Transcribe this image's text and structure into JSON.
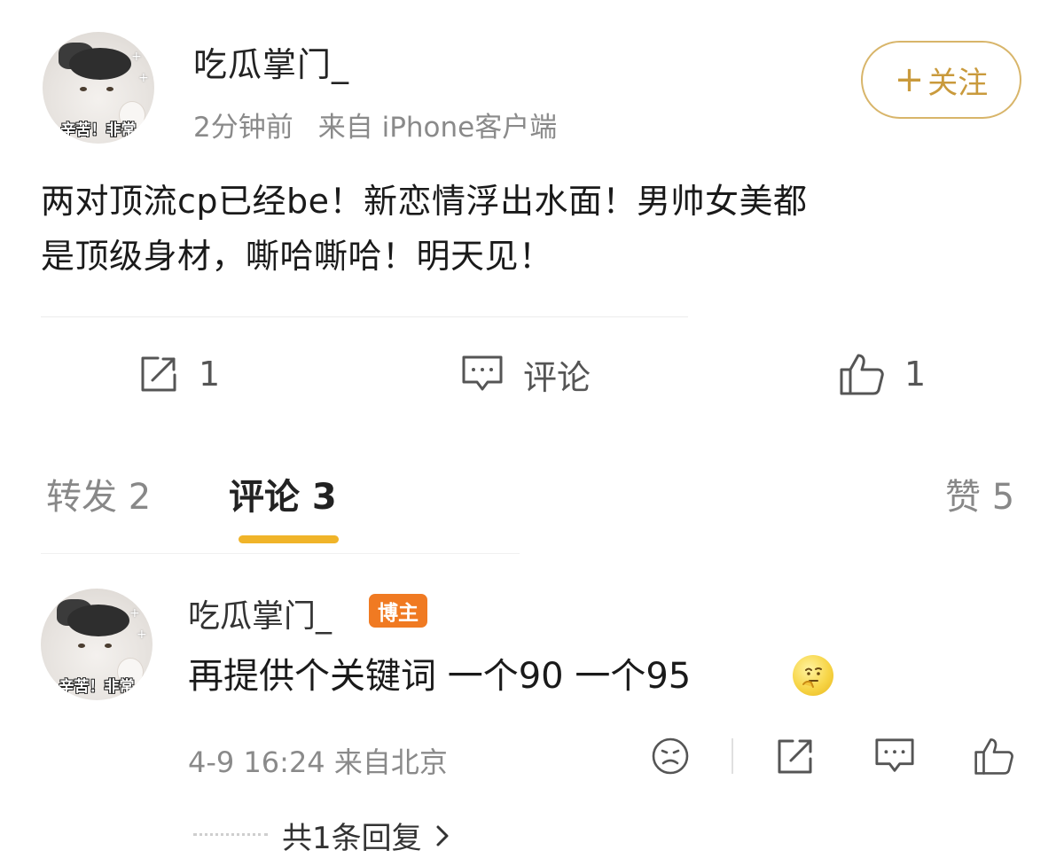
{
  "post": {
    "username": "吃瓜掌门_",
    "avatar_caption": "辛苦！非常",
    "time": "2分钟前",
    "source": "来自 iPhone客户端",
    "follow_label": "关注",
    "follow_plus": "+",
    "text_line1": "两对顶流cp已经be！新恋情浮出水面！男帅女美都",
    "text_line2": "是顶级身材，嘶哈嘶哈！明天见！"
  },
  "actions": {
    "repost_count": "1",
    "comment_label": "评论",
    "like_count": "1"
  },
  "tabs": {
    "repost": "转发 2",
    "comment": "评论 3",
    "like": "赞 5",
    "active": "comment",
    "accent_color": "#f0b429"
  },
  "comment": {
    "username": "吃瓜掌门_",
    "badge": "博主",
    "badge_color": "#f07a22",
    "text": "再提供个关键词 一个90 一个95",
    "emoji": "thinking-emoji",
    "meta": "4-9 16:24 来自北京",
    "reply_link": "共1条回复"
  },
  "icons": {
    "repost": "share-icon",
    "comment": "comment-icon",
    "like": "thumbs-up-icon",
    "comment_actions": [
      "sad-face-icon",
      "share-icon",
      "comment-icon",
      "thumbs-up-icon"
    ]
  }
}
